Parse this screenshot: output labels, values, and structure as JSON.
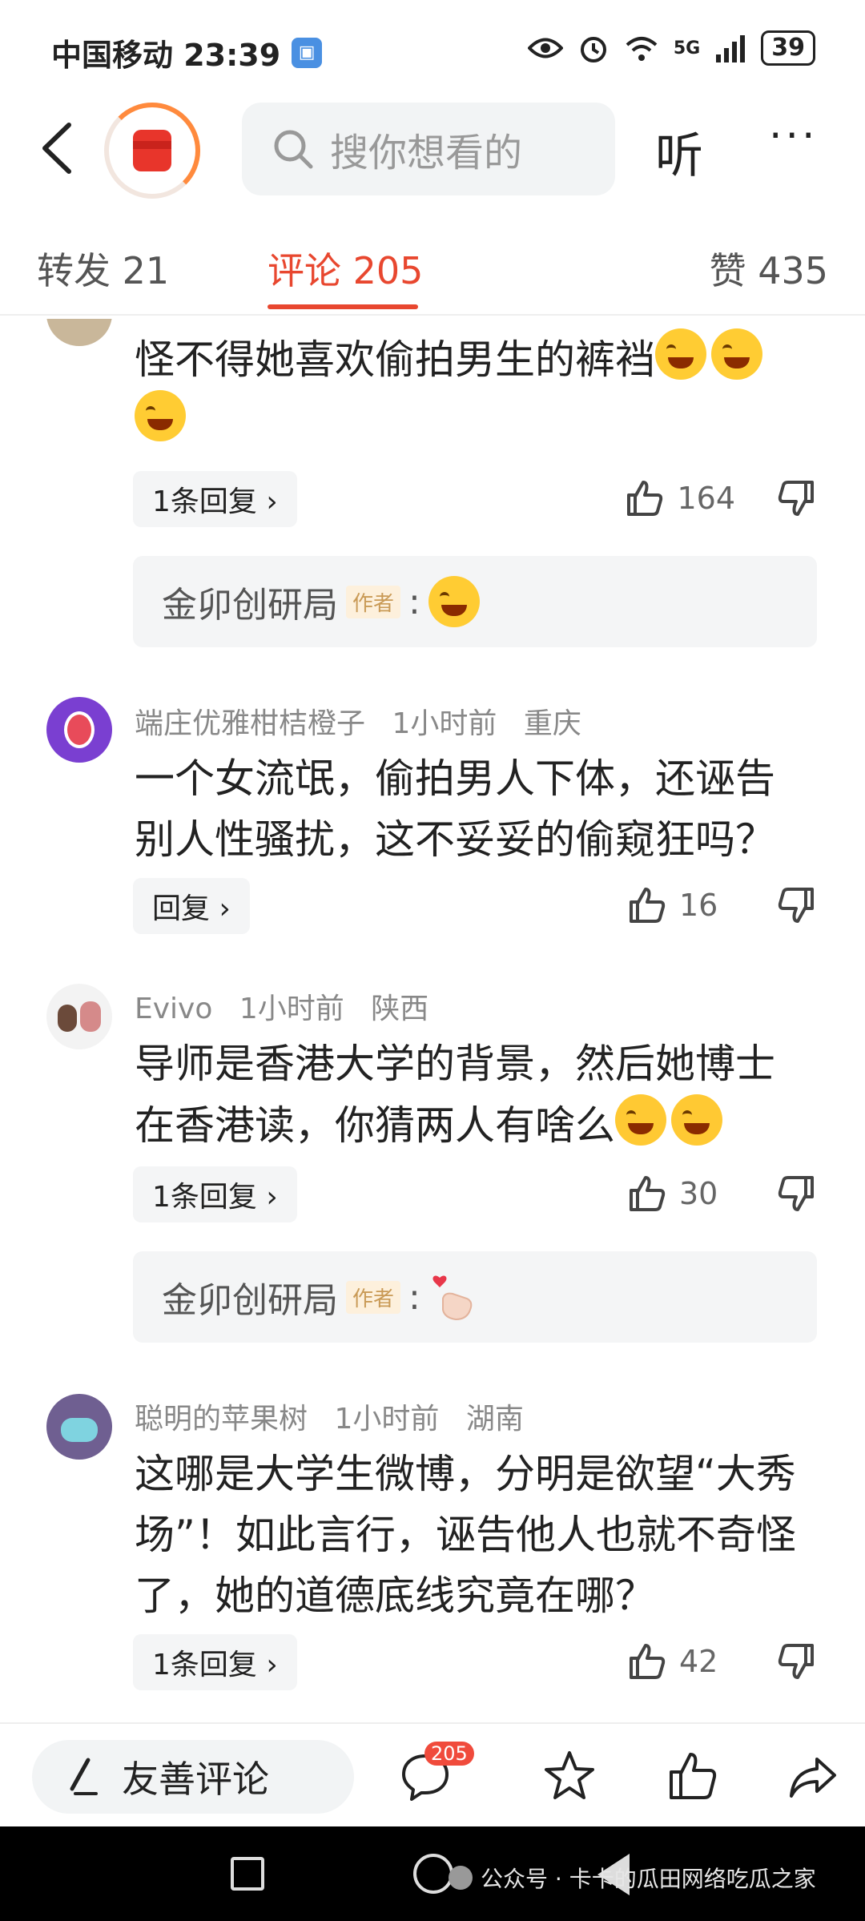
{
  "status_bar": {
    "carrier_time": "中国移动 23:39",
    "network": "5G",
    "battery": "39"
  },
  "top_nav": {
    "search_placeholder": "搜你想看的",
    "listen_label": "听",
    "more_label": "···"
  },
  "tabs": {
    "forward": "转发 21",
    "comments": "评论 205",
    "likes": "赞 435"
  },
  "comments": [
    {
      "body": "怪不得她喜欢偷拍男生的裤裆",
      "reply_label": "1条回复 ›",
      "like_count": "164",
      "author_reply": {
        "name": "金卯创研局",
        "tag": "作者",
        "sep": ":"
      }
    },
    {
      "username": "端庄优雅柑桔橙子",
      "time": "1小时前",
      "location": "重庆",
      "body": "一个女流氓，偷拍男人下体，还诬告别人性骚扰，这不妥妥的偷窥狂吗？",
      "reply_label": "回复 ›",
      "like_count": "16"
    },
    {
      "username": "Evivo",
      "time": "1小时前",
      "location": "陕西",
      "body": "导师是香港大学的背景，然后她博士在香港读，你猜两人有啥么",
      "reply_label": "1条回复 ›",
      "like_count": "30",
      "author_reply": {
        "name": "金卯创研局",
        "tag": "作者",
        "sep": ":"
      }
    },
    {
      "username": "聪明的苹果树",
      "time": "1小时前",
      "location": "湖南",
      "body": "这哪是大学生微博，分明是欲望“大秀场”！如此言行，诬告他人也就不奇怪了，她的道德底线究竟在哪？",
      "reply_label": "1条回复 ›",
      "like_count": "42"
    }
  ],
  "bottom_bar": {
    "compose_label": "友善评论",
    "comment_count": "205"
  },
  "watermark": "公众号 · 卡卡的瓜田网络吃瓜之家"
}
